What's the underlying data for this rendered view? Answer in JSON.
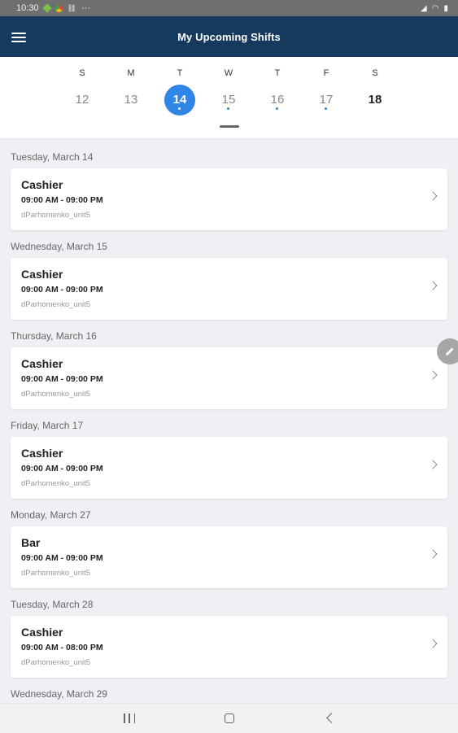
{
  "status_bar": {
    "time": "10:30",
    "dots": "···"
  },
  "app_bar": {
    "title": "My Upcoming Shifts",
    "menu_icon": "hamburger-menu-icon"
  },
  "week": {
    "days": [
      {
        "letter": "S",
        "num": "12",
        "selected": false,
        "has_shift": false,
        "bold": false
      },
      {
        "letter": "M",
        "num": "13",
        "selected": false,
        "has_shift": false,
        "bold": false
      },
      {
        "letter": "T",
        "num": "14",
        "selected": true,
        "has_shift": true,
        "bold": false
      },
      {
        "letter": "W",
        "num": "15",
        "selected": false,
        "has_shift": true,
        "bold": false
      },
      {
        "letter": "T",
        "num": "16",
        "selected": false,
        "has_shift": true,
        "bold": false
      },
      {
        "letter": "F",
        "num": "17",
        "selected": false,
        "has_shift": true,
        "bold": false
      },
      {
        "letter": "S",
        "num": "18",
        "selected": false,
        "has_shift": false,
        "bold": true
      }
    ],
    "accent_color": "#2f86e6"
  },
  "shifts": [
    {
      "date": "Tuesday, March 14",
      "role": "Cashier",
      "time": "09:00 AM - 09:00 PM",
      "unit": "dParhomenko_unit5"
    },
    {
      "date": "Wednesday, March 15",
      "role": "Cashier",
      "time": "09:00 AM - 09:00 PM",
      "unit": "dParhomenko_unit5"
    },
    {
      "date": "Thursday, March 16",
      "role": "Cashier",
      "time": "09:00 AM - 09:00 PM",
      "unit": "dParhomenko_unit5"
    },
    {
      "date": "Friday, March 17",
      "role": "Cashier",
      "time": "09:00 AM - 09:00 PM",
      "unit": "dParhomenko_unit5"
    },
    {
      "date": "Monday, March 27",
      "role": "Bar",
      "time": "09:00 AM - 09:00 PM",
      "unit": "dParhomenko_unit5"
    },
    {
      "date": "Tuesday, March 28",
      "role": "Cashier",
      "time": "09:00 AM - 08:00 PM",
      "unit": "dParhomenko_unit5"
    }
  ],
  "trailing_header": {
    "date": "Wednesday, March 29"
  },
  "colors": {
    "app_bar": "#163a5e",
    "background": "#eef0f4"
  }
}
